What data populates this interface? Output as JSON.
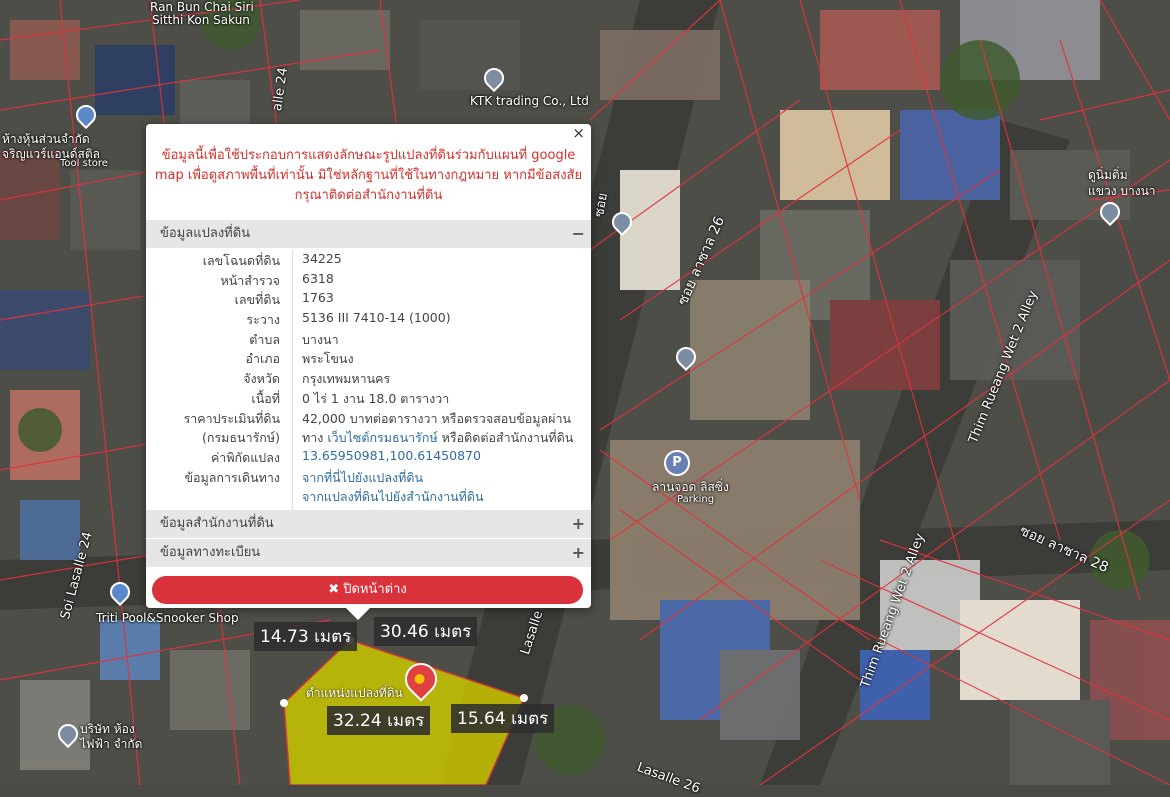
{
  "map": {
    "labels": [
      {
        "text": "Ran Bun Chai Siri"
      },
      {
        "text": "Sitthi Kon Sakun"
      },
      {
        "text": "KTK trading Co., Ltd"
      },
      {
        "text": "ห้างหุ้นส่วนจำกัด"
      },
      {
        "text": "จริญแวร์แอนด์สติล"
      },
      {
        "text": "Tool store"
      },
      {
        "text": "ซอย ลาซาล 26"
      },
      {
        "text": "Thim Rueang Wet 2 Alley"
      },
      {
        "text": "ซอย ลาซาล 28"
      },
      {
        "text": "Thim Rueang Wet 2 Alley"
      },
      {
        "text": "ดูนิ่มติ่ม"
      },
      {
        "text": "แขวง บางนา"
      },
      {
        "text": "ลานจอด ลิสซิ่ง"
      },
      {
        "text": "Parking"
      },
      {
        "text": "Soi Lasalle 24"
      },
      {
        "text": "Triti Pool&Snooker Shop"
      },
      {
        "text": "Lasalle"
      },
      {
        "text": "Lasalle 26"
      },
      {
        "text": "บริษัท ห้อง"
      },
      {
        "text": "ไฟฟ้า จำกัด"
      },
      {
        "text": "alle 24"
      },
      {
        "text": "ซอย"
      }
    ],
    "measurements": [
      "14.73 เมตร",
      "30.46 เมตร",
      "32.24 เมตร",
      "15.64 เมตร"
    ],
    "parcel_label": "ตำแหน่งแปลงที่ดิน",
    "parking_letter": "P",
    "colors": {
      "parcel_fill": "#c9c500",
      "parcel_lines": "#e3323a"
    }
  },
  "popup": {
    "close_symbol": "×",
    "notice": "ข้อมูลนี้เพื่อใช้ประกอบการแสดงลักษณะรูปแปลงที่ดินร่วมกับแผนที่ google map เพื่อดูสภาพพื้นที่เท่านั้น มิใช่หลักฐานที่ใช้ในทางกฎหมาย หากมีข้อสงสัย กรุณาติดต่อสำนักงานที่ดิน",
    "section_parcel": {
      "title": "ข้อมูลแปลงที่ดิน",
      "toggle": "−"
    },
    "rows": [
      {
        "k": "เลขโฉนดที่ดิน",
        "v": "34225"
      },
      {
        "k": "หน้าสำรวจ",
        "v": "6318"
      },
      {
        "k": "เลขที่ดิน",
        "v": "1763"
      },
      {
        "k": "ระวาง",
        "v": "5136 III 7410-14 (1000)"
      },
      {
        "k": "ตำบล",
        "v": "บางนา"
      },
      {
        "k": "อำเภอ",
        "v": "พระโขนง"
      },
      {
        "k": "จังหวัด",
        "v": "กรุงเทพมหานคร"
      },
      {
        "k": "เนื้อที่",
        "v": "0 ไร่ 1 งาน 18.0 ตารางวา"
      }
    ],
    "price": {
      "k1": "ราคาประเมินที่ดิน",
      "k2": "(กรมธนารักษ์)",
      "v1": "42,000 บาทต่อตารางวา หรือตรวจสอบข้อมูลผ่าน",
      "v2_pre": "ทาง ",
      "v2_link": "เว็บไซต์กรมธนารักษ์",
      "v2_post": " หรือติดต่อสำนักงานที่ดิน"
    },
    "coord": {
      "k": "ค่าพิกัดแปลง",
      "v": "13.65950981,100.61450870"
    },
    "directions": {
      "k": "ข้อมูลการเดินทาง",
      "v1": "จากที่นี่ไปยังแปลงที่ดิน",
      "v2": "จากแปลงที่ดินไปยังสำนักงานที่ดิน"
    },
    "section_office": {
      "title": "ข้อมูลสำนักงานที่ดิน",
      "toggle": "+"
    },
    "section_registry": {
      "title": "ข้อมูลทางทะเบียน",
      "toggle": "+"
    },
    "close_button": "✖ ปิดหน้าต่าง"
  }
}
